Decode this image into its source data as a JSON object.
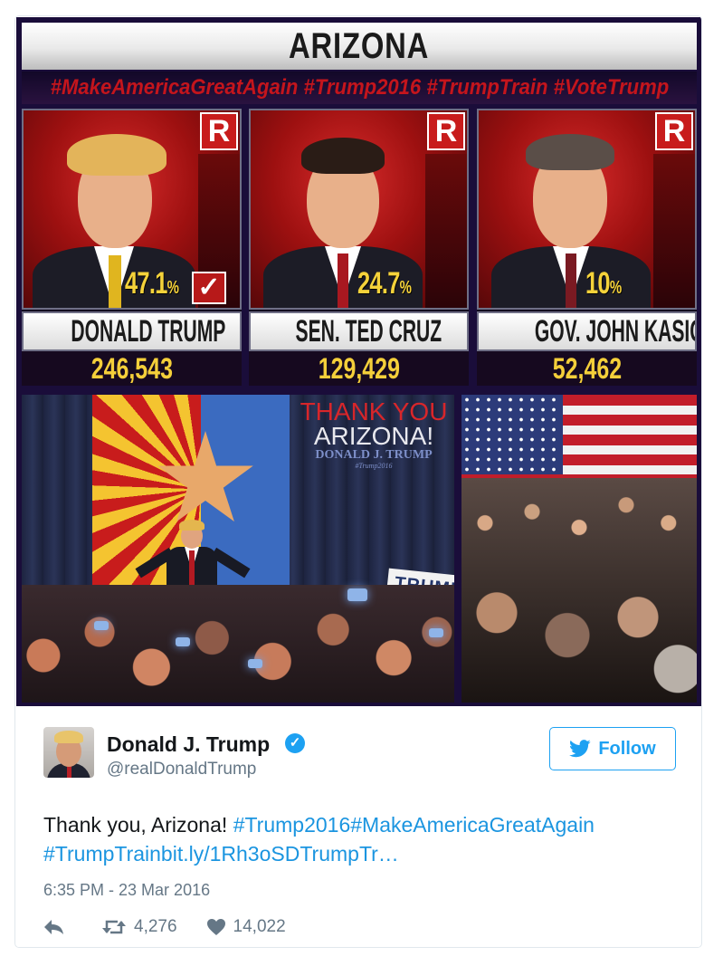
{
  "media": {
    "banner_title": "ARIZONA",
    "hashtag_bar": "#MakeAmericaGreatAgain #Trump2016 #TrumpTrain #VoteTrump",
    "party_badge": "R",
    "candidates": [
      {
        "name": "DONALD TRUMP",
        "percent": "47.1",
        "percent_unit": "%",
        "votes": "246,543",
        "winner_check": "✓"
      },
      {
        "name": "SEN. TED CRUZ",
        "percent": "24.7",
        "percent_unit": "%",
        "votes": "129,429"
      },
      {
        "name": "GOV. JOHN KASICH",
        "percent": "10",
        "percent_unit": "%",
        "votes": "52,462"
      }
    ],
    "thank_line1": "THANK YOU",
    "thank_line2": "ARIZONA!",
    "thank_line3": "DONALD J. TRUMP",
    "thank_line4": "#Trump2016",
    "sign_text": "TRUMP"
  },
  "tweet": {
    "display_name": "Donald J. Trump",
    "handle": "@realDonaldTrump",
    "follow_label": "Follow",
    "text_plain": "Thank you, Arizona! ",
    "text_hashtags_line1": "#Trump2016#MakeAmericaGreatAgain",
    "text_line2": "#TrumpTrainbit.ly/1Rh3oSDTrumpTr…",
    "timestamp": "6:35 PM - 23 Mar 2016",
    "retweets": "4,276",
    "likes": "14,022"
  },
  "colors": {
    "twitter_blue": "#1da1f2",
    "link_blue": "#1b95e0",
    "party_red": "#c81c1c",
    "percent_yellow": "#f5d23a"
  },
  "icons": [
    "verified-badge-icon",
    "twitter-bird-icon",
    "reply-icon",
    "retweet-icon",
    "heart-icon",
    "checkmark-icon"
  ]
}
